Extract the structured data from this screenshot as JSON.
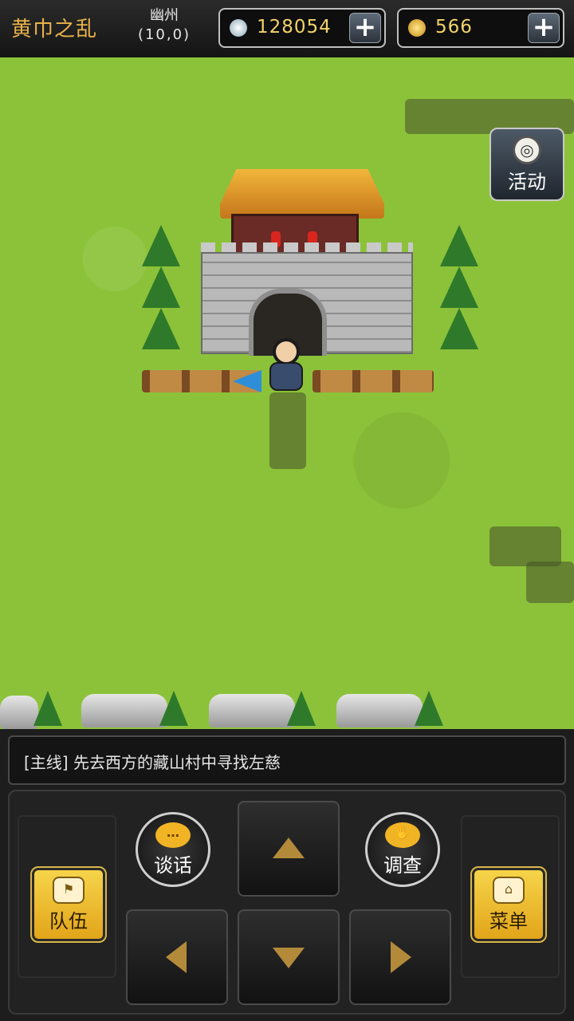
{
  "header": {
    "chapter_title": "黄巾之乱",
    "location_name": "幽州",
    "location_coords": "(10,0)",
    "silver": {
      "icon": "silver-coin-icon",
      "value": "128054",
      "add_label": "+"
    },
    "gold": {
      "icon": "gold-coin-icon",
      "value": "566",
      "add_label": "+"
    }
  },
  "map": {
    "event_button_label": "活动",
    "event_icon": "drum-icon"
  },
  "quest": {
    "text": "[主线] 先去西方的藏山村中寻找左慈"
  },
  "controls": {
    "talk_label": "谈话",
    "talk_icon": "speech-bubble-icon",
    "talk_icon_glyph": "…",
    "investigate_label": "调查",
    "investigate_icon": "hand-icon",
    "investigate_icon_glyph": "✋",
    "team_label": "队伍",
    "team_icon": "banner-icon",
    "team_icon_glyph": "⚑",
    "menu_label": "菜单",
    "menu_icon": "gate-icon",
    "menu_icon_glyph": "⌂",
    "dpad": [
      "up",
      "down",
      "left",
      "right"
    ]
  },
  "colors": {
    "accent_gold": "#e8b24a",
    "grass": "#8cc23a",
    "dpad_arrow": "#b38a3a",
    "yellow_button": "#f6d44a"
  }
}
